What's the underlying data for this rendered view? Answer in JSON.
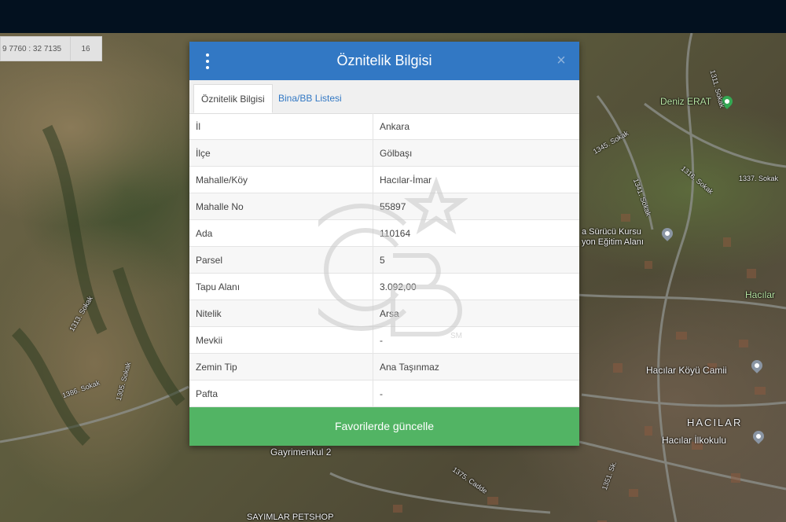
{
  "map": {
    "coords": "9 7760 : 32 7135",
    "zoom": "16",
    "labels": {
      "deniz_erat": "Deniz ERAT",
      "surucu_kursu_line1": "a Sürücü Kursu",
      "surucu_kursu_line2": "yon Eğitim Alanı",
      "hacilar": "Hacılar",
      "hacilar_koyu_camii": "Hacılar Köyü Camii",
      "hacilar_big": "HACILAR",
      "hacilar_ilkokulu": "Hacılar İlkokulu",
      "gayrimenkul": "Gayrimenkul 2",
      "petshop": "SAYIMLAR PETSHOP",
      "sokak_1313": "1313. Sokak",
      "sokak_1311": "1311. Sokak",
      "sokak_1316": "1316. Sokak",
      "sokak_1337": "1337. Sokak",
      "sokak_1341": "1341. Sokak",
      "sokak_1345": "1345. Sokak",
      "sokak_1351": "1351. Sk.",
      "sokak_1375": "1375. Cadde",
      "sokak_1305": "1305. Sokak",
      "sokak_1386": "1386. Sokak"
    },
    "accent_pin": "#34a853"
  },
  "dialog": {
    "title": "Öznitelik Bilgisi",
    "close": "×",
    "header_color": "#3278c4",
    "tabs": [
      {
        "label": "Öznitelik Bilgisi",
        "active": true
      },
      {
        "label": "Bina/BB Listesi",
        "active": false
      }
    ],
    "rows": [
      {
        "key": "İl",
        "value": "Ankara"
      },
      {
        "key": "İlçe",
        "value": "Gölbaşı"
      },
      {
        "key": "Mahalle/Köy",
        "value": "Hacılar-İmar"
      },
      {
        "key": "Mahalle No",
        "value": "55897"
      },
      {
        "key": "Ada",
        "value": "110164"
      },
      {
        "key": "Parsel",
        "value": "5"
      },
      {
        "key": "Tapu Alanı",
        "value": "3.092,00"
      },
      {
        "key": "Nitelik",
        "value": "Arsa"
      },
      {
        "key": "Mevkii",
        "value": "-"
      },
      {
        "key": "Zemin Tip",
        "value": "Ana Taşınmaz"
      },
      {
        "key": "Pafta",
        "value": "-"
      }
    ],
    "fav_button": "Favorilerde güncelle",
    "fav_color": "#52b464"
  },
  "watermark": {
    "mark": "SM"
  }
}
